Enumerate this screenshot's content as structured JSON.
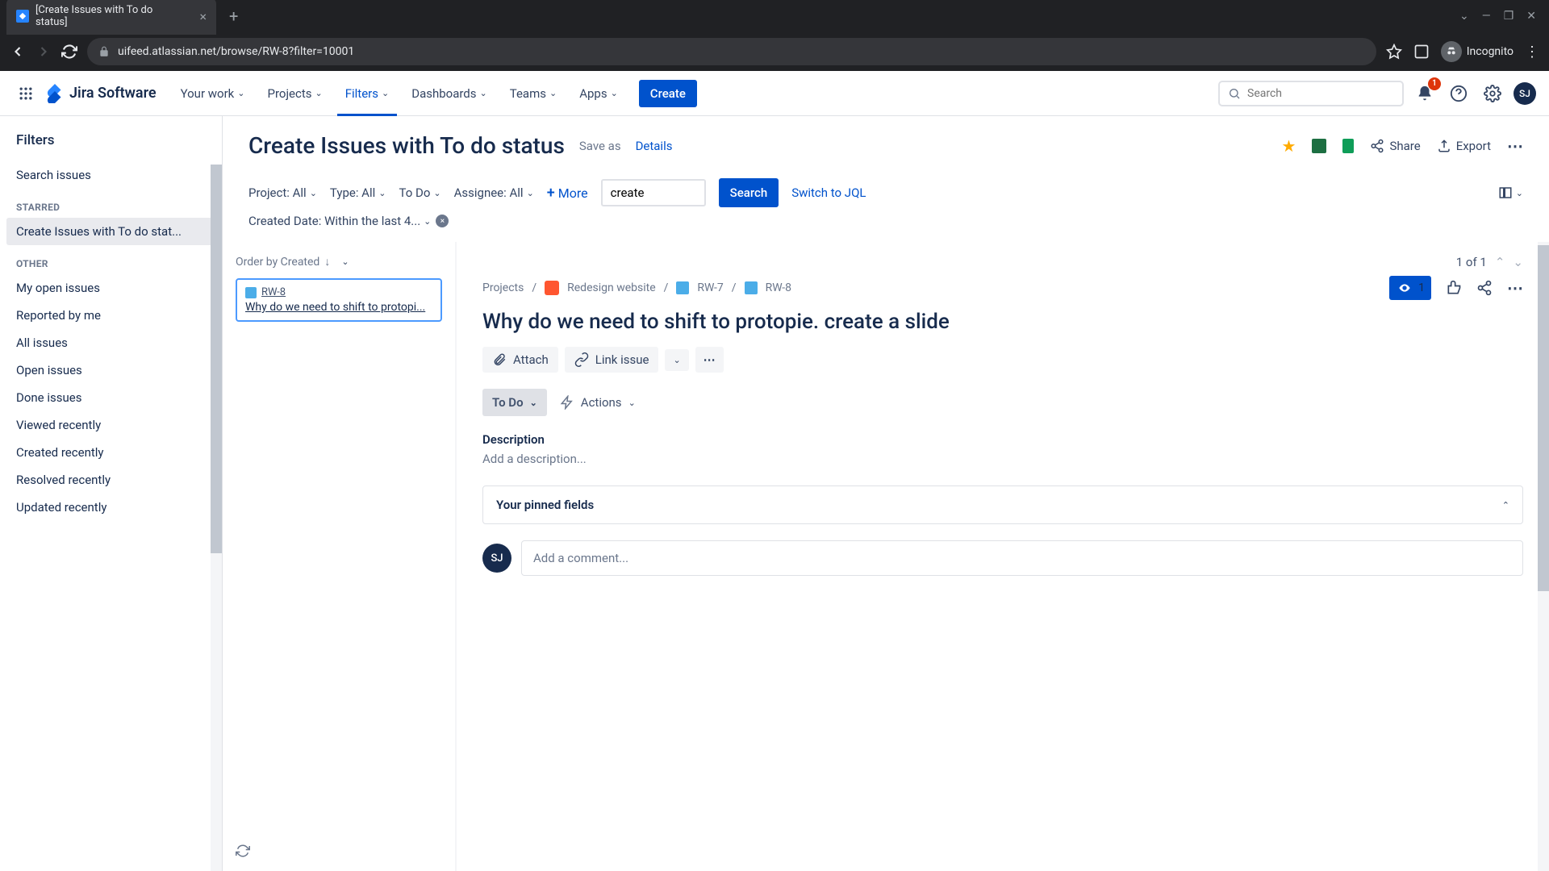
{
  "browser": {
    "tab_title": "[Create Issues with To do status]",
    "url": "uifeed.atlassian.net/browse/RW-8?filter=10001",
    "incognito_label": "Incognito"
  },
  "nav": {
    "product": "Jira Software",
    "items": {
      "your_work": "Your work",
      "projects": "Projects",
      "filters": "Filters",
      "dashboards": "Dashboards",
      "teams": "Teams",
      "apps": "Apps"
    },
    "create": "Create",
    "search_placeholder": "Search",
    "notif_count": "1",
    "user_initials": "SJ"
  },
  "sidebar": {
    "title": "Filters",
    "search_issues": "Search issues",
    "starred_heading": "STARRED",
    "starred": {
      "i0": "Create Issues with To do stat..."
    },
    "other_heading": "OTHER",
    "other": {
      "i0": "My open issues",
      "i1": "Reported by me",
      "i2": "All issues",
      "i3": "Open issues",
      "i4": "Done issues",
      "i5": "Viewed recently",
      "i6": "Created recently",
      "i7": "Resolved recently",
      "i8": "Updated recently"
    }
  },
  "header": {
    "title": "Create Issues with To do status",
    "save_as": "Save as",
    "details": "Details",
    "share": "Share",
    "export": "Export"
  },
  "filters": {
    "project": "Project: All",
    "type": "Type: All",
    "status": "To Do",
    "assignee": "Assignee: All",
    "more": "More",
    "search_value": "create",
    "search_btn": "Search",
    "jql": "Switch to JQL",
    "created_date": "Created Date: Within the last 4..."
  },
  "list": {
    "order_by": "Order by Created",
    "issue_key": "RW-8",
    "issue_summary": "Why do we need to shift to protopi..."
  },
  "detail": {
    "pager": "1 of 1",
    "breadcrumb": {
      "projects": "Projects",
      "project_name": "Redesign website",
      "parent": "RW-7",
      "key": "RW-8"
    },
    "watch_count": "1",
    "title": "Why do we need to shift to protopie. create a slide",
    "attach": "Attach",
    "link_issue": "Link issue",
    "status": "To Do",
    "actions": "Actions",
    "description_label": "Description",
    "description_placeholder": "Add a description...",
    "pinned_title": "Your pinned fields",
    "comment_placeholder": "Add a comment...",
    "comment_initials": "SJ"
  }
}
